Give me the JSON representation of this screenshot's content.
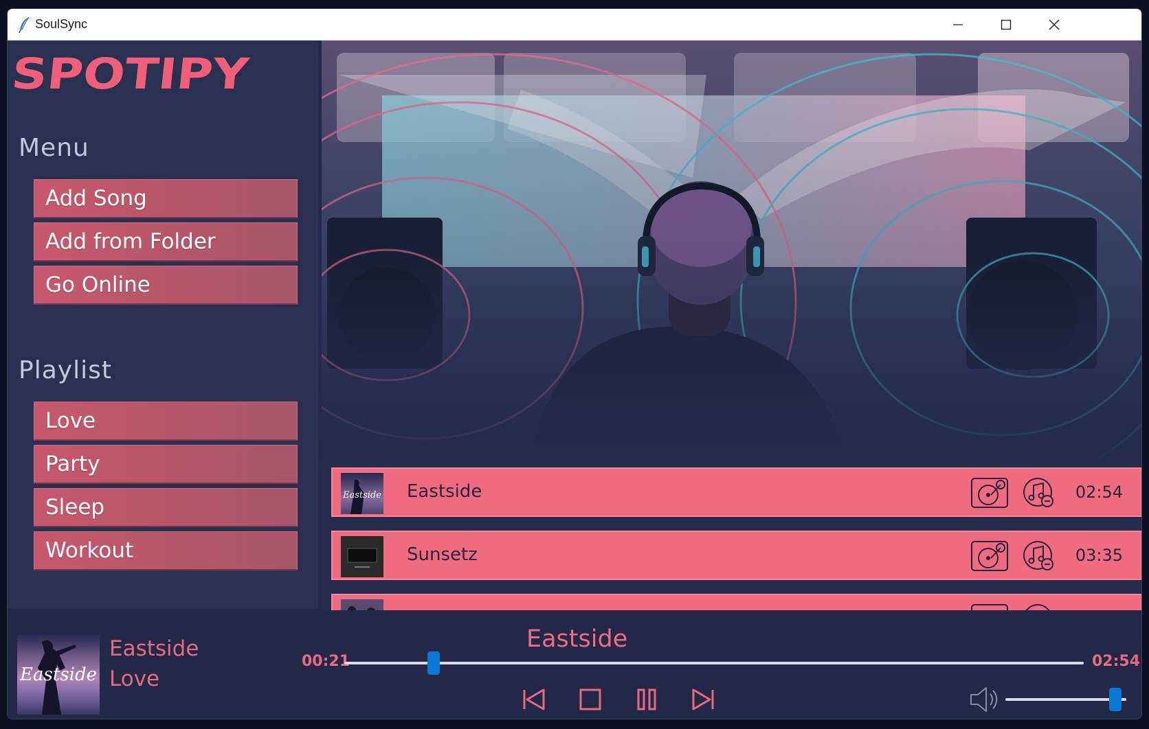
{
  "window": {
    "title": "SoulSync"
  },
  "sidebar": {
    "logo": "SPOTIPY",
    "menu_title": "Menu",
    "menu_items": [
      {
        "label": "Add Song"
      },
      {
        "label": "Add from Folder"
      },
      {
        "label": "Go Online"
      }
    ],
    "playlist_title": "Playlist",
    "playlists": [
      {
        "label": "Love"
      },
      {
        "label": "Party"
      },
      {
        "label": "Sleep"
      },
      {
        "label": "Workout"
      }
    ]
  },
  "songs": [
    {
      "title": "Eastside",
      "duration": "02:54",
      "thumb_text": "Eastside"
    },
    {
      "title": "Sunsetz",
      "duration": "03:35"
    }
  ],
  "player": {
    "now_playing_title": "Eastside",
    "now_playing_playlist": "Love",
    "art_text": "Eastside",
    "center_title": "Eastside",
    "elapsed": "00:21",
    "total": "02:54",
    "progress_fraction": 0.121,
    "volume_fraction": 0.91
  },
  "colors": {
    "accent_pink": "#ef6b80",
    "button_red": "#c7586f",
    "slider_blue": "#0a78d7",
    "panel_navy": "#2a3150"
  },
  "icons": [
    "feather-icon",
    "minimize-icon",
    "maximize-icon",
    "close-icon",
    "vinyl-add-icon",
    "music-remove-icon",
    "previous-icon",
    "stop-icon",
    "pause-icon",
    "next-icon",
    "volume-icon"
  ]
}
